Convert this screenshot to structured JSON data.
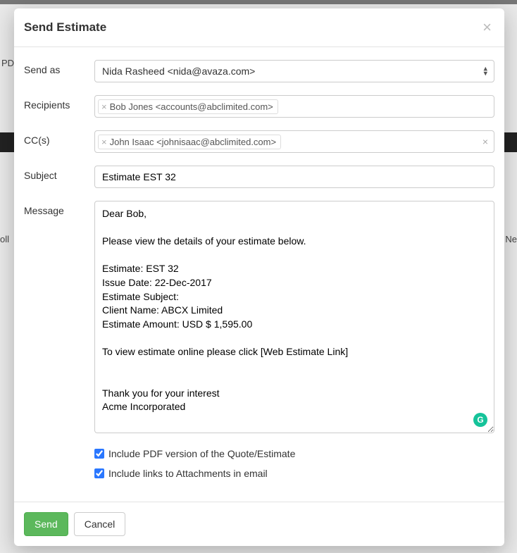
{
  "modal": {
    "title": "Send Estimate",
    "close_glyph": "×"
  },
  "labels": {
    "send_as": "Send as",
    "recipients": "Recipients",
    "ccs": "CC(s)",
    "subject": "Subject",
    "message": "Message"
  },
  "send_as": {
    "selected": "Nida Rasheed <nida@avaza.com>"
  },
  "recipients": [
    "Bob Jones <accounts@abclimited.com>"
  ],
  "ccs": [
    "John Isaac <johnisaac@abclimited.com>"
  ],
  "subject": "Estimate EST 32",
  "message": "Dear Bob,\n\nPlease view the details of your estimate below.\n\nEstimate: EST 32\nIssue Date: 22-Dec-2017\nEstimate Subject:\nClient Name: ABCX Limited\nEstimate Amount: USD $ 1,595.00\n\nTo view estimate online please click [Web Estimate Link]\n\n\nThank you for your interest\nAcme Incorporated",
  "options": {
    "include_pdf": {
      "checked": true,
      "label": "Include PDF version of the Quote/Estimate"
    },
    "include_attachment_links": {
      "checked": true,
      "label": "Include links to Attachments in email"
    }
  },
  "buttons": {
    "send": "Send",
    "cancel": "Cancel"
  },
  "bg": {
    "pd": "PD",
    "coll": "oll",
    "ne": "Ne"
  },
  "glyphs": {
    "tag_x": "×",
    "field_x": "×",
    "caret_up": "▴",
    "caret_down": "▾",
    "g": "G"
  }
}
